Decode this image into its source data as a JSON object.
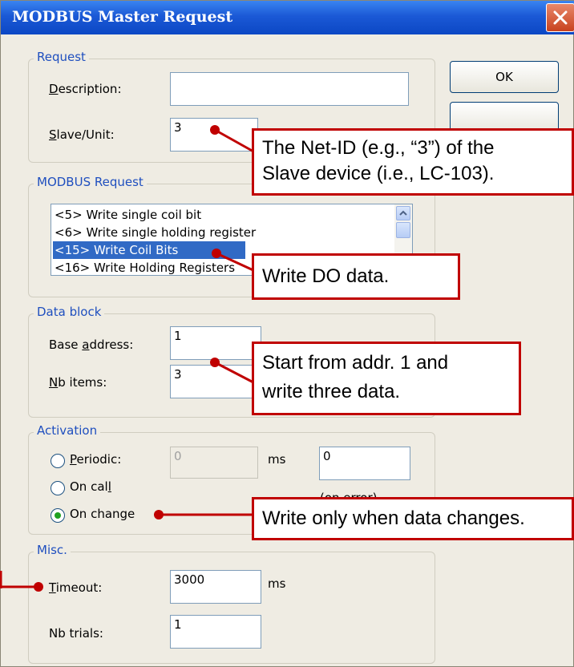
{
  "window": {
    "title": "MODBUS Master Request",
    "close_icon": "close-icon"
  },
  "buttons": {
    "ok": "OK"
  },
  "request": {
    "group_label": "Request",
    "description_label": "Description:",
    "description_value": "",
    "slave_label": "Slave/Unit:",
    "slave_value": "3"
  },
  "modbus": {
    "group_label": "MODBUS Request",
    "items": [
      "<5> Write single coil bit",
      "<6> Write single holding register",
      "<15> Write Coil Bits",
      "<16> Write Holding Registers"
    ],
    "selected": "<15> Write Coil Bits"
  },
  "data_block": {
    "group_label": "Data block",
    "base_label": "Base address:",
    "base_value": "1",
    "nb_label": "Nb items:",
    "nb_value": "3"
  },
  "activation": {
    "group_label": "Activation",
    "periodic_label": "Periodic:",
    "periodic_value": "0",
    "ms_label": "ms",
    "error_value": "0",
    "on_error_label": "(on error)",
    "on_call_label": "On call",
    "on_change_label": "On change",
    "selected": "On change"
  },
  "misc": {
    "group_label": "Misc.",
    "timeout_label": "Timeout:",
    "timeout_value": "3000",
    "ms_label": "ms",
    "trials_label": "Nb trials:",
    "trials_value": "1"
  },
  "annotations": {
    "slave": [
      "The Net-ID (e.g., “3”) of the",
      "Slave device (i.e., LC-103)."
    ],
    "request": "Write DO data.",
    "data": [
      "Start from addr. 1 and",
      "write three data."
    ],
    "change": "Write only when data changes.",
    "color": "#c00000"
  }
}
